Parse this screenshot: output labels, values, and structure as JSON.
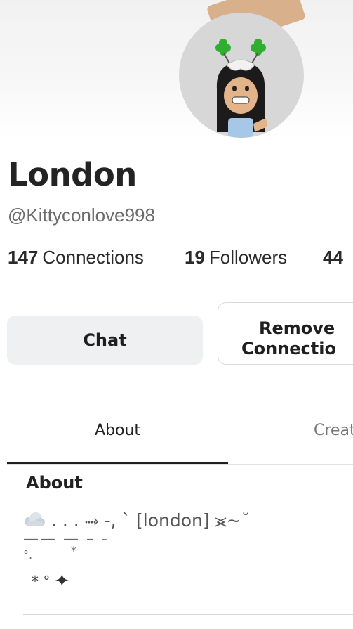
{
  "profile": {
    "display_name": "London",
    "username": "@Kittyconlove998"
  },
  "stats": [
    {
      "count": "147",
      "label": "Connections"
    },
    {
      "count": "19",
      "label": "Followers"
    },
    {
      "count": "44",
      "label": ""
    }
  ],
  "actions": {
    "chat_label": "Chat",
    "remove_line1": "Remove",
    "remove_line2": "Connectio"
  },
  "tabs": [
    {
      "label": "About",
      "active": true
    },
    {
      "label": "Creat",
      "active": false
    }
  ],
  "about": {
    "heading": "About",
    "bio_line1_text": ". . . ⤑ -, ` [london] ⪤∼˘",
    "bio_line2": "—— — – -",
    "bio_line3_a": "°.",
    "bio_line3_b": "*",
    "bio_line4_text": "* °"
  },
  "icons": {
    "cloud": "cloud-icon",
    "sparkle": "sparkle-icon"
  },
  "colors": {
    "chat_button_bg": "#eff0f2",
    "avatar_bg": "#d7d7d7",
    "active_tab_underline": "#1f1f1f"
  }
}
